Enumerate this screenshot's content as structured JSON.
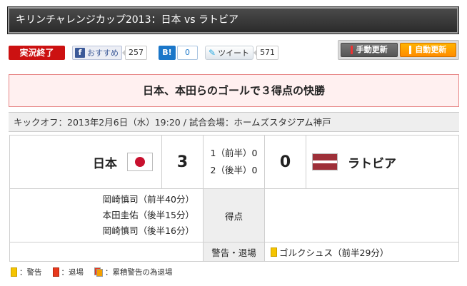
{
  "title": "キリンチャレンジカップ2013：日本 vs ラトビア",
  "status_badge": "実況終了",
  "social": {
    "facebook_label": "おすすめ",
    "facebook_count": "257",
    "hatena_label": "B!",
    "hatena_count": "0",
    "twitter_label": "ツイート",
    "twitter_count": "571"
  },
  "update": {
    "manual_label": "手動更新",
    "auto_label": "自動更新"
  },
  "headline": "日本、本田らのゴールで３得点の快勝",
  "kickoff": "キックオフ：2013年2月6日（水）19:20 / 試合会場：ホームズスタジアム神戸",
  "match": {
    "home_team": "日本",
    "away_team": "ラトビア",
    "home_score": "3",
    "away_score": "0",
    "first_half": "1（前半）0",
    "second_half": "2（後半）0"
  },
  "goals": {
    "label": "得点",
    "home_scorers": [
      "岡崎慎司（前半40分）",
      "本田圭佑（後半15分）",
      "岡崎慎司（後半16分）"
    ],
    "away_scorers": []
  },
  "cards": {
    "label": "警告・退場",
    "home": "",
    "away": "ゴルクシュス（前半29分）"
  },
  "legend": {
    "yellow": "：警告",
    "red": "：退場",
    "accumulated": "：累積警告の為退場"
  },
  "colors": {
    "badge_red": "#cc1111",
    "headline_bg": "#fff0f0",
    "headline_border": "#e78787",
    "auto_update_orange": "#ff9a00"
  }
}
